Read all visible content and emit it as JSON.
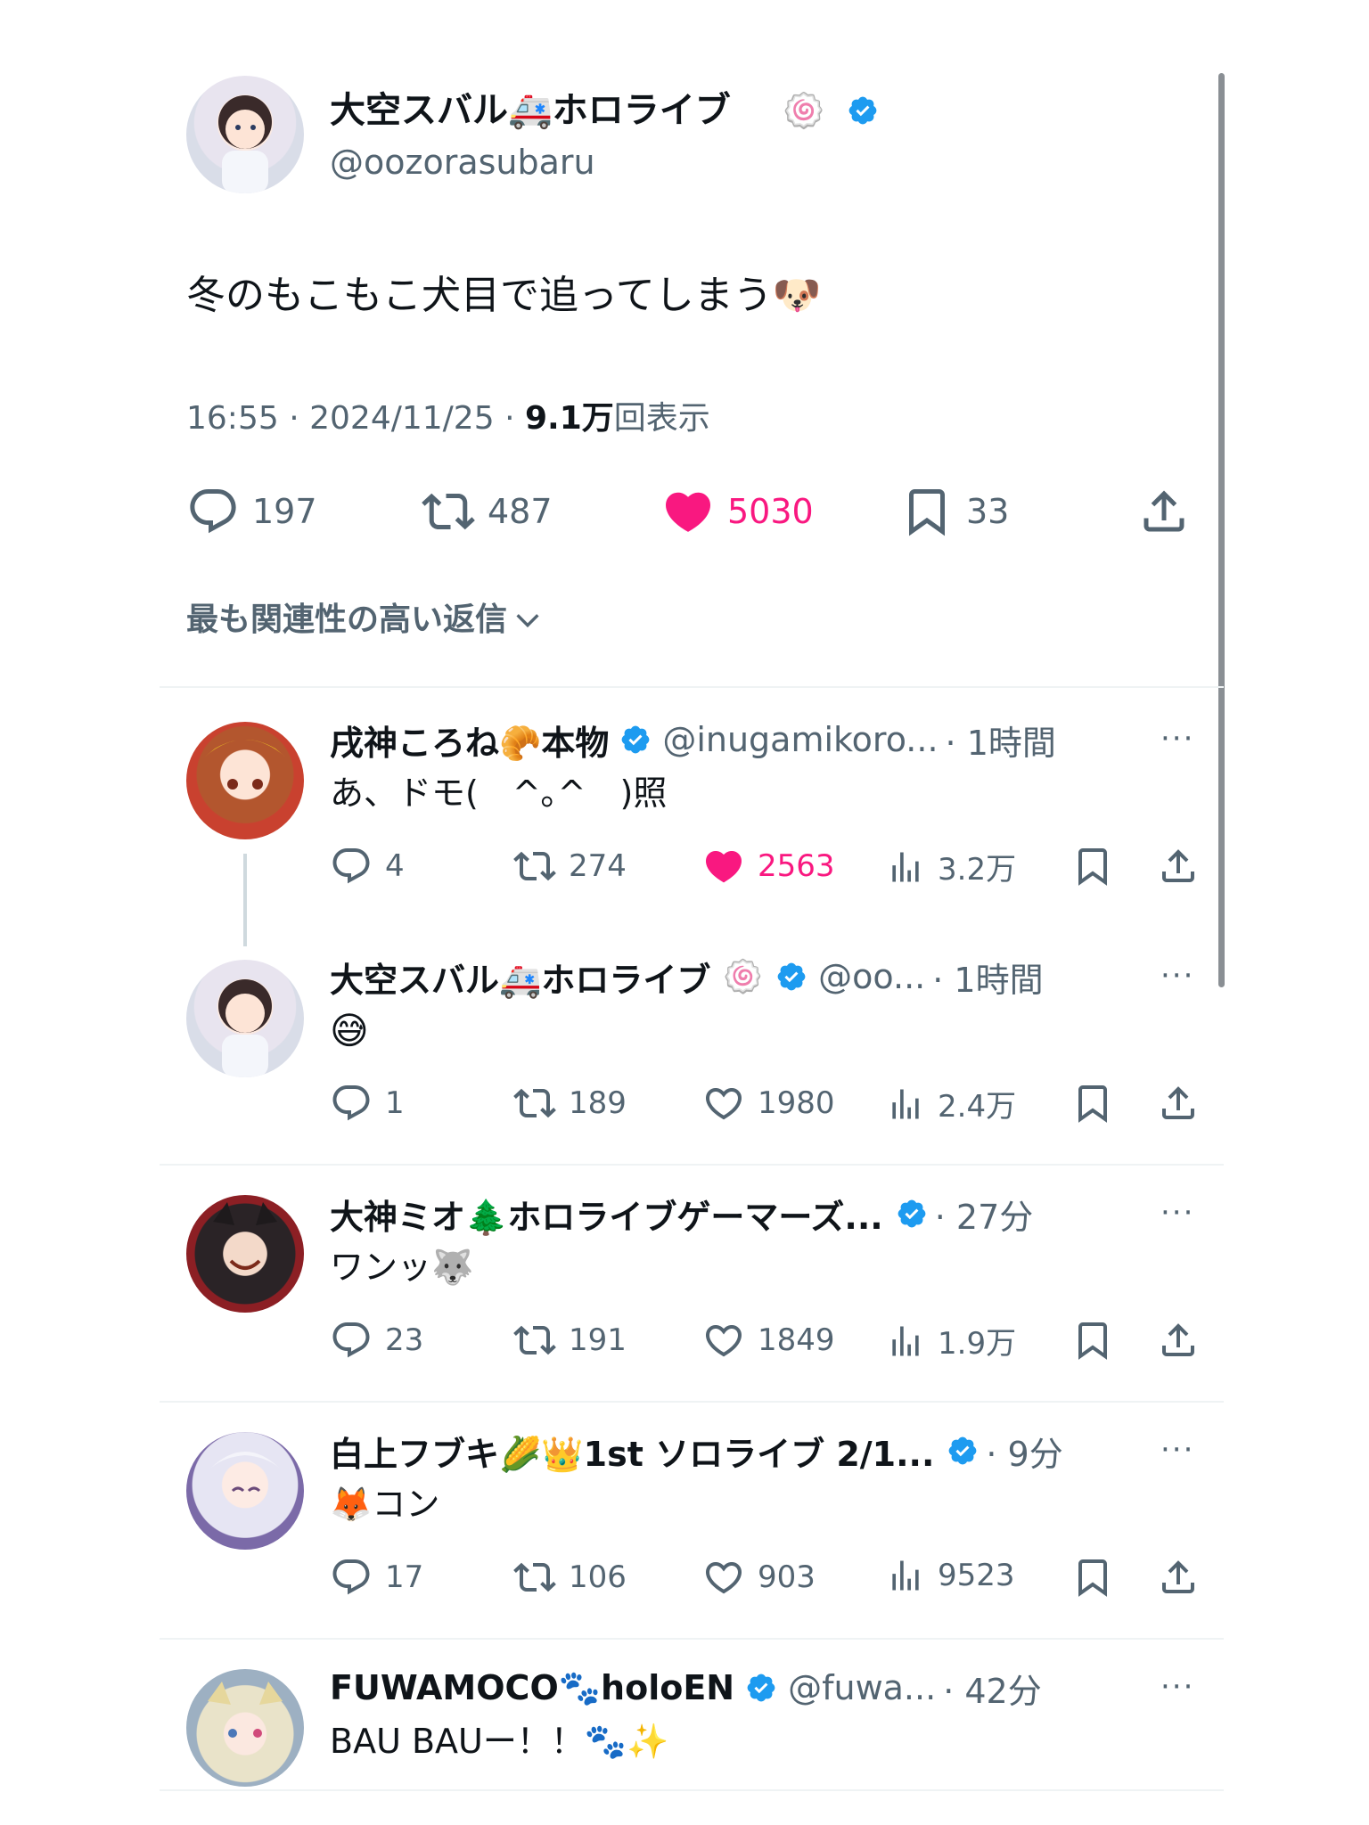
{
  "main_post": {
    "display_name": "大空スバル🚑ホロライブ",
    "badge_emoji": "🍥",
    "handle": "@oozorasubaru",
    "text": "冬のもこもこ犬目で追ってしまう🐶",
    "time": "16:55",
    "sep1": "·",
    "date": "2024/11/25",
    "sep2": "·",
    "views": "9.1万",
    "views_suffix": "回表示",
    "stats": {
      "replies": "197",
      "reposts": "487",
      "likes": "5030",
      "bookmarks": "33"
    },
    "liked": true
  },
  "sort_label": "最も関連性の高い返信",
  "replies": [
    {
      "name": "戌神ころね🥐本物",
      "handle": "@inugamikoro...",
      "time": "· 1時間",
      "text": "あ、ドモ(　^｡^　)照",
      "replies": "4",
      "reposts": "274",
      "likes": "2563",
      "views": "3.2万",
      "liked": true
    },
    {
      "name": "大空スバル🚑ホロライブ",
      "badge_emoji": "🍥",
      "handle": "@oo...",
      "time": "· 1時間",
      "text": "😅",
      "replies": "1",
      "reposts": "189",
      "likes": "1980",
      "views": "2.4万",
      "liked": false
    },
    {
      "name": "大神ミオ🌲ホロライブゲーマーズ...",
      "handle": "",
      "time": "· 27分",
      "text": "ワンッ🐺",
      "replies": "23",
      "reposts": "191",
      "likes": "1849",
      "views": "1.9万",
      "liked": false
    },
    {
      "name": "白上フブキ🌽👑1st ソロライブ 2/1...",
      "handle": "",
      "time": "· 9分",
      "text": "🦊コン",
      "replies": "17",
      "reposts": "106",
      "likes": "903",
      "views": "9523",
      "liked": false
    },
    {
      "name": "FUWAMOCO🐾holoEN",
      "handle": "@fuwa...",
      "time": "· 42分",
      "text": "BAU BAUー！！🐾✨"
    }
  ],
  "more_glyph": "···",
  "colors": {
    "like": "#f91880",
    "verified": "#1d9bf0",
    "muted": "#536471",
    "divider": "#eff3f4"
  }
}
